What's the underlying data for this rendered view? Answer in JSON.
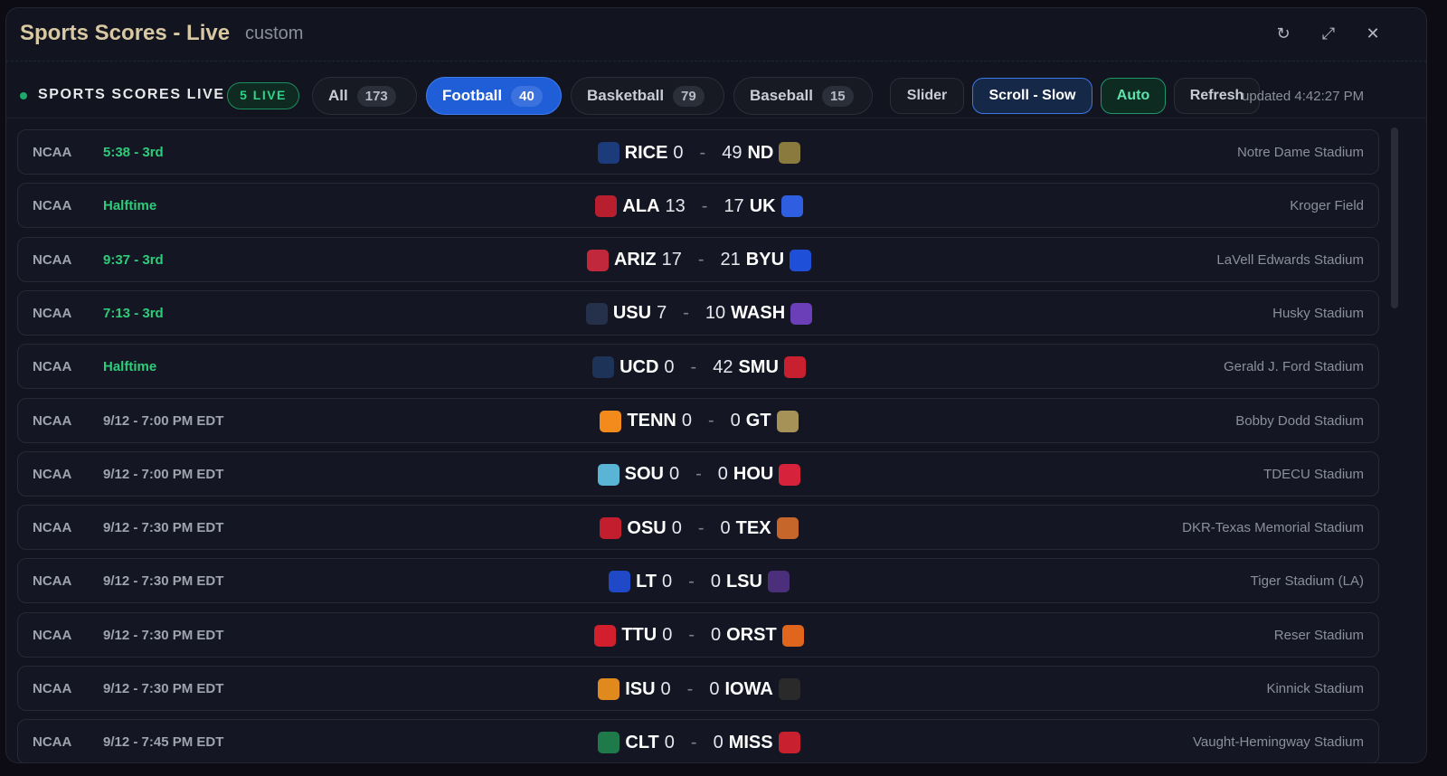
{
  "window": {
    "title": "Sports Scores - Live",
    "subtitle": "custom"
  },
  "toolbar": {
    "live_title": "SPORTS SCORES LIVE",
    "live_badge": "5 LIVE",
    "filters": [
      {
        "label": "All",
        "count": "173",
        "active": false
      },
      {
        "label": "Football",
        "count": "40",
        "active": true
      },
      {
        "label": "Basketball",
        "count": "79",
        "active": false
      },
      {
        "label": "Baseball",
        "count": "15",
        "active": false
      }
    ],
    "buttons": {
      "slider": "Slider",
      "scroll": "Scroll - Slow",
      "auto": "Auto",
      "refresh": "Refresh"
    },
    "updated": "updated 4:42:27 PM"
  },
  "games": [
    {
      "league": "NCAA",
      "status": "5:38 - 3rd",
      "live": true,
      "away": "RICE",
      "away_score": "0",
      "home": "ND",
      "home_score": "49",
      "venue": "Notre Dame Stadium",
      "away_color": "#1b3b7a",
      "home_color": "#8a7a3d"
    },
    {
      "league": "NCAA",
      "status": "Halftime",
      "live": true,
      "away": "ALA",
      "away_score": "13",
      "home": "UK",
      "home_score": "17",
      "venue": "Kroger Field",
      "away_color": "#b81f2e",
      "home_color": "#2f5fe0"
    },
    {
      "league": "NCAA",
      "status": "9:37 - 3rd",
      "live": true,
      "away": "ARIZ",
      "away_score": "17",
      "home": "BYU",
      "home_score": "21",
      "venue": "LaVell Edwards Stadium",
      "away_color": "#c1283c",
      "home_color": "#1d4fd8"
    },
    {
      "league": "NCAA",
      "status": "7:13 - 3rd",
      "live": true,
      "away": "USU",
      "away_score": "7",
      "home": "WASH",
      "home_score": "10",
      "venue": "Husky Stadium",
      "away_color": "#25314a",
      "home_color": "#6b3fb8"
    },
    {
      "league": "NCAA",
      "status": "Halftime",
      "live": true,
      "away": "UCD",
      "away_score": "0",
      "home": "SMU",
      "home_score": "42",
      "venue": "Gerald J. Ford Stadium",
      "away_color": "#1e3358",
      "home_color": "#c8202f"
    },
    {
      "league": "NCAA",
      "status": "9/12 - 7:00 PM EDT",
      "live": false,
      "away": "TENN",
      "away_score": "0",
      "home": "GT",
      "home_score": "0",
      "venue": "Bobby Dodd Stadium",
      "away_color": "#f28a1c",
      "home_color": "#a69257"
    },
    {
      "league": "NCAA",
      "status": "9/12 - 7:00 PM EDT",
      "live": false,
      "away": "SOU",
      "away_score": "0",
      "home": "HOU",
      "home_score": "0",
      "venue": "TDECU Stadium",
      "away_color": "#5ab4d6",
      "home_color": "#d6223a"
    },
    {
      "league": "NCAA",
      "status": "9/12 - 7:30 PM EDT",
      "live": false,
      "away": "OSU",
      "away_score": "0",
      "home": "TEX",
      "home_score": "0",
      "venue": "DKR-Texas Memorial Stadium",
      "away_color": "#c21e2e",
      "home_color": "#c7662a"
    },
    {
      "league": "NCAA",
      "status": "9/12 - 7:30 PM EDT",
      "live": false,
      "away": "LT",
      "away_score": "0",
      "home": "LSU",
      "home_score": "0",
      "venue": "Tiger Stadium (LA)",
      "away_color": "#1f49c6",
      "home_color": "#4b2f7a"
    },
    {
      "league": "NCAA",
      "status": "9/12 - 7:30 PM EDT",
      "live": false,
      "away": "TTU",
      "away_score": "0",
      "home": "ORST",
      "home_score": "0",
      "venue": "Reser Stadium",
      "away_color": "#d11f2e",
      "home_color": "#e0661e"
    },
    {
      "league": "NCAA",
      "status": "9/12 - 7:30 PM EDT",
      "live": false,
      "away": "ISU",
      "away_score": "0",
      "home": "IOWA",
      "home_score": "0",
      "venue": "Kinnick Stadium",
      "away_color": "#e08a1e",
      "home_color": "#2a2a2a"
    },
    {
      "league": "NCAA",
      "status": "9/12 - 7:45 PM EDT",
      "live": false,
      "away": "CLT",
      "away_score": "0",
      "home": "MISS",
      "home_score": "0",
      "venue": "Vaught-Hemingway Stadium",
      "away_color": "#1f7a4a",
      "home_color": "#c8202f"
    }
  ]
}
